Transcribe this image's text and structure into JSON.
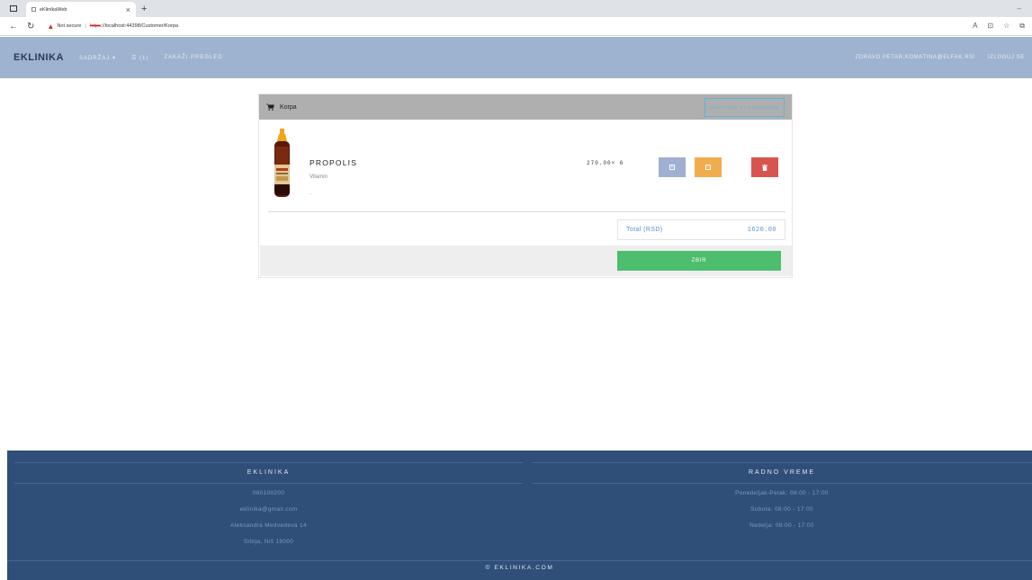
{
  "browser": {
    "tab_title": "eKlinikaWeb",
    "tab_close": "×",
    "new_tab": "+",
    "window_minimize": "–",
    "back": "←",
    "reload": "↻",
    "security_label": "Not secure",
    "url_scheme": "https",
    "url_rest": "://localhost:44398/Customer/Korpa"
  },
  "navbar": {
    "brand": "EKLINIKA",
    "menu_content": "SADRŽAJ ▾",
    "menu_cart": "☰ (1)",
    "menu_appointment": "ZAKAŽI PREGLED",
    "greeting": "ZDRAVO PETAR.KOMATINA@ELFAK.RS!",
    "logout": "IZLOGUJ SE"
  },
  "cart": {
    "title": "Korpa",
    "continue_label": "NASTAVITE SA KUPOVINOM",
    "items": [
      {
        "name": "PROPOLIS",
        "category": "Vitamin",
        "description": "-",
        "price_qty": "270.00× 6",
        "plus_symbol": "+",
        "minus_symbol": "−",
        "delete_symbol": "🗑"
      }
    ],
    "total_label": "Total (RSD)",
    "total_value": "1620.00",
    "sum_label": "ZBIR"
  },
  "footer": {
    "left_heading": "EKLINIKA",
    "phone": "060100200",
    "email": "eklinika@gmail.com",
    "address": "Aleksandra Medvedeva 14",
    "city": "Srbija, Niš 18000",
    "right_heading": "RADNO VREME",
    "hours_weekday": "Ponedeljak-Petak: 08:00 - 17:00",
    "hours_saturday": "Subota: 08:00 - 17:00",
    "hours_sunday": "Nedelja: 08:00 - 17:00",
    "copyright": "© EKLINIKA.COM"
  },
  "colors": {
    "navbar": "#9eb3cf",
    "footer": "#2f4f79",
    "plus_button": "#9fb0d0",
    "minus_button": "#f0ad4e",
    "delete_button": "#d9534f",
    "sum_button": "#4dbe6e",
    "continue_border": "#5ab3df"
  },
  "icons": {
    "cart": "cart-icon",
    "warning": "warning-icon",
    "plus": "plus-icon",
    "minus": "minus-icon",
    "delete": "trash-icon"
  }
}
